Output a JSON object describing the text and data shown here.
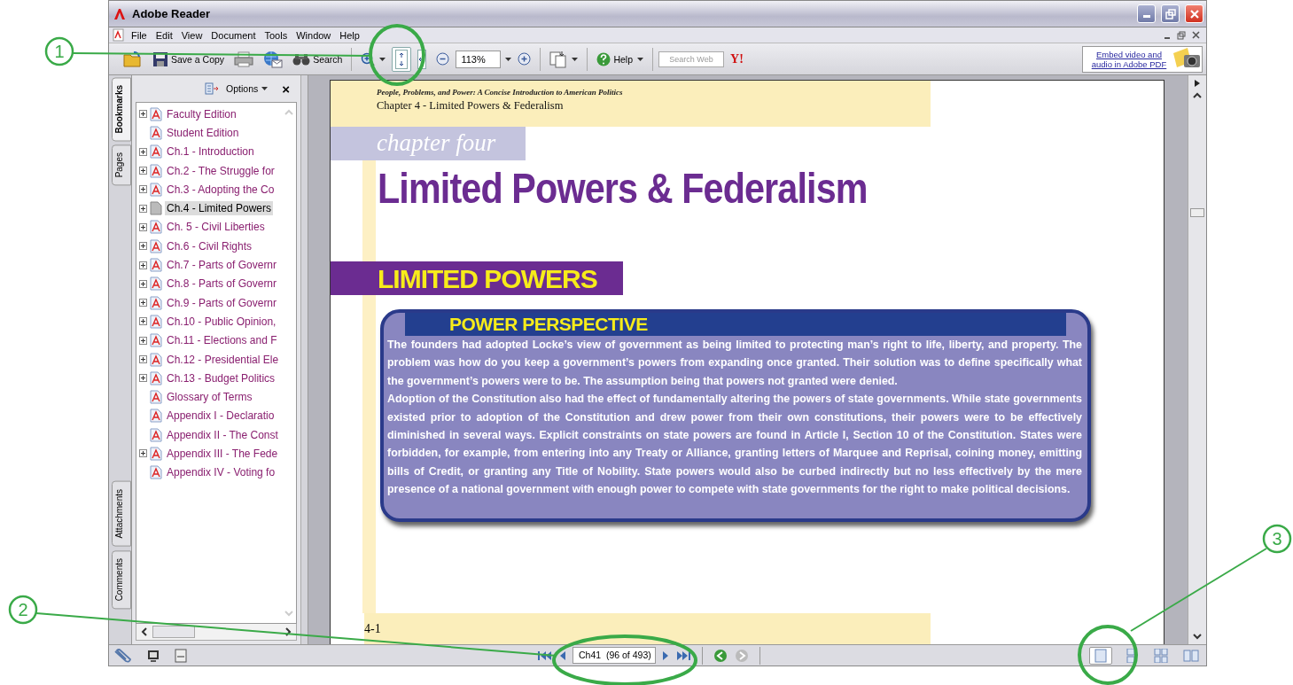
{
  "window": {
    "title": "Adobe Reader"
  },
  "menu": [
    "File",
    "Edit",
    "View",
    "Document",
    "Tools",
    "Window",
    "Help"
  ],
  "toolbar": [
    {
      "kind": "open",
      "selected": false
    },
    {
      "kind": "save",
      "label": "Save a Copy",
      "selected": false
    },
    {
      "kind": "print",
      "selected": false
    },
    {
      "kind": "email",
      "selected": false
    },
    {
      "kind": "search",
      "label": "Search",
      "selected": false
    },
    {
      "kind": "separator"
    },
    {
      "kind": "zoom-tool",
      "selected": false
    },
    {
      "kind": "fit-height",
      "selected": true
    },
    {
      "kind": "fit-width",
      "selected": false
    },
    {
      "kind": "zoom-out",
      "selected": false
    },
    {
      "kind": "zoom-field",
      "value": "113%"
    },
    {
      "kind": "zoom-in",
      "selected": false
    },
    {
      "kind": "separator"
    },
    {
      "kind": "page-tool",
      "selected": false
    },
    {
      "kind": "separator"
    },
    {
      "kind": "help",
      "label": "Help",
      "selected": false
    },
    {
      "kind": "separator"
    },
    {
      "kind": "search-web",
      "placeholder": "Search Web"
    },
    {
      "kind": "yahoo",
      "label": "Y!"
    }
  ],
  "promo": {
    "text": "Embed video and audio in Adobe PDF"
  },
  "side_tabs": {
    "top": [
      {
        "label": "Bookmarks",
        "selected": true
      },
      {
        "label": "Pages",
        "selected": false
      }
    ],
    "bottom": [
      {
        "label": "Attachments",
        "selected": false
      },
      {
        "label": "Comments",
        "selected": false
      }
    ]
  },
  "bookmarks_panel": {
    "options": "Options",
    "close": "×",
    "items": [
      {
        "label": "Faculty Edition",
        "kind": "expandable",
        "selected": false
      },
      {
        "label": "Student Edition",
        "kind": "leaf",
        "selected": false
      },
      {
        "label": "Ch.1 - Introduction",
        "kind": "expandable",
        "selected": false
      },
      {
        "label": "Ch.2 - The Struggle for",
        "kind": "expandable",
        "selected": false
      },
      {
        "label": "Ch.3 - Adopting the Co",
        "kind": "expandable",
        "selected": false
      },
      {
        "label": "Ch.4 - Limited Powers",
        "kind": "expandable",
        "selected": true
      },
      {
        "label": "Ch. 5 - Civil Liberties",
        "kind": "expandable",
        "selected": false
      },
      {
        "label": "Ch.6 - Civil Rights",
        "kind": "expandable",
        "selected": false
      },
      {
        "label": "Ch.7 - Parts of Governr",
        "kind": "expandable",
        "selected": false
      },
      {
        "label": "Ch.8 - Parts of Governr",
        "kind": "expandable",
        "selected": false
      },
      {
        "label": "Ch.9 - Parts of Governr",
        "kind": "expandable",
        "selected": false
      },
      {
        "label": "Ch.10 - Public Opinion,",
        "kind": "expandable",
        "selected": false
      },
      {
        "label": "Ch.11 - Elections and F",
        "kind": "expandable",
        "selected": false
      },
      {
        "label": "Ch.12 - Presidential Ele",
        "kind": "expandable",
        "selected": false
      },
      {
        "label": "Ch.13 - Budget Politics",
        "kind": "expandable",
        "selected": false
      },
      {
        "label": "Glossary of Terms",
        "kind": "leaf",
        "selected": false
      },
      {
        "label": "Appendix I - Declaratio",
        "kind": "leaf",
        "selected": false
      },
      {
        "label": "Appendix II - The Const",
        "kind": "leaf",
        "selected": false
      },
      {
        "label": "Appendix III - The Fede",
        "kind": "expandable",
        "selected": false
      },
      {
        "label": "Appendix IV - Voting fo",
        "kind": "leaf",
        "selected": false
      }
    ]
  },
  "document": {
    "book_title": "People, Problems, and Power: A Concise Introduction to American Politics",
    "running_head": "Chapter 4 - Limited Powers & Federalism",
    "chapter_label": "chapter four",
    "chapter_title": "Limited Powers & Federalism",
    "section_heading": "LIMITED POWERS",
    "box": {
      "heading": "POWER PERSPECTIVE",
      "paragraphs": [
        "The founders had adopted Locke’s view of government as being limited to protecting man’s right to life, liberty, and property. The problem was how do you keep a government’s powers from expanding once granted. Their solution was to define specifically what the government’s powers were to be. The assumption being that powers not granted were denied.",
        "Adoption of the Constitution also had the effect of fundamentally altering the powers of state governments. While state governments existed prior to adoption of the Constitution and drew power from their own constitutions, their powers were to be effectively diminished in several ways. Explicit constraints on state powers are found in Article I, Section 10 of the Constitution. States were forbidden, for example, from entering into any Treaty or Alliance, granting letters of Marquee and Reprisal, coining money, emitting bills of Credit, or granting any Title of Nobility. State powers would also be curbed indirectly but no less effectively by the mere presence of a national government with enough power to compete with state governments for the right to make political decisions."
      ]
    },
    "page_number": "4-1"
  },
  "status_bar": {
    "page_field": "Ch41  (96 of 493)",
    "views": [
      {
        "kind": "single",
        "selected": true
      },
      {
        "kind": "continuous",
        "selected": false
      },
      {
        "kind": "continuous-facing",
        "selected": false
      },
      {
        "kind": "facing",
        "selected": false
      }
    ]
  },
  "annotations": [
    "1",
    "2",
    "3"
  ]
}
